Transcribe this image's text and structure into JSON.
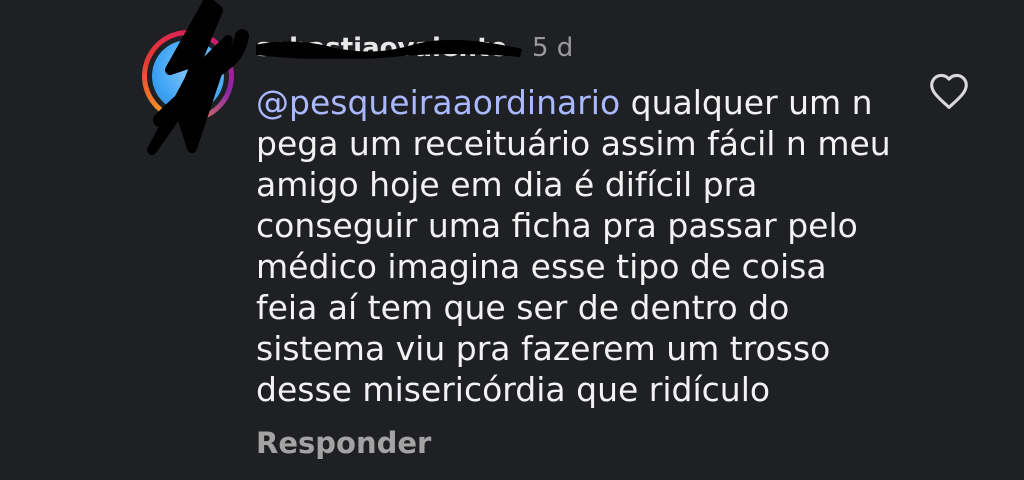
{
  "comment": {
    "username": "sebastiaovalente",
    "timestamp": "5 d",
    "mention": "@pesqueiraaordinario",
    "text": "qualquer um n pega um receituário assim fácil n meu amigo hoje em dia é difícil pra conseguir uma ficha pra passar pelo médico imagina esse tipo de coisa feia aí tem que ser de dentro do sistema viu pra fazerem um trosso desse misericórdia que ridículo",
    "reply_label": "Responder",
    "like_icon": "heart-outline-icon"
  },
  "colors": {
    "background": "#1f2023",
    "mention": "#a9b8ff",
    "muted": "#9a9a9a",
    "text": "#f2f2f2"
  }
}
